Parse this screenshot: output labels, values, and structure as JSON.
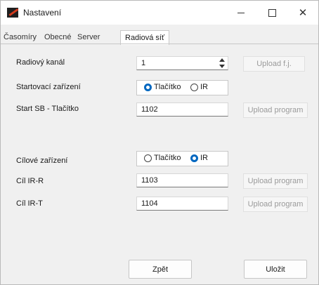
{
  "window": {
    "title": "Nastavení"
  },
  "tabs": [
    {
      "label": "Časomíry"
    },
    {
      "label": "Obecné"
    },
    {
      "label": "Server"
    },
    {
      "label": "Radiová síť"
    }
  ],
  "form": {
    "radio_channel": {
      "label": "Radiový kanál",
      "value": "1",
      "button": "Upload f.j."
    },
    "start_device": {
      "label": "Startovací zařízení",
      "options": [
        "Tlačítko",
        "IR"
      ],
      "selected": "Tlačítko"
    },
    "start_sb": {
      "label": "Start SB - Tlačítko",
      "value": "1102",
      "button": "Upload program"
    },
    "finish_device": {
      "label": "Cílové zařízení",
      "options": [
        "Tlačítko",
        "IR"
      ],
      "selected": "IR"
    },
    "finish_ir_r": {
      "label": "Cíl IR-R",
      "value": "1103",
      "button": "Upload program"
    },
    "finish_ir_t": {
      "label": "Cíl IR-T",
      "value": "1104",
      "button": "Upload program"
    }
  },
  "footer": {
    "back_label": "Zpět",
    "save_label": "Uložit"
  }
}
